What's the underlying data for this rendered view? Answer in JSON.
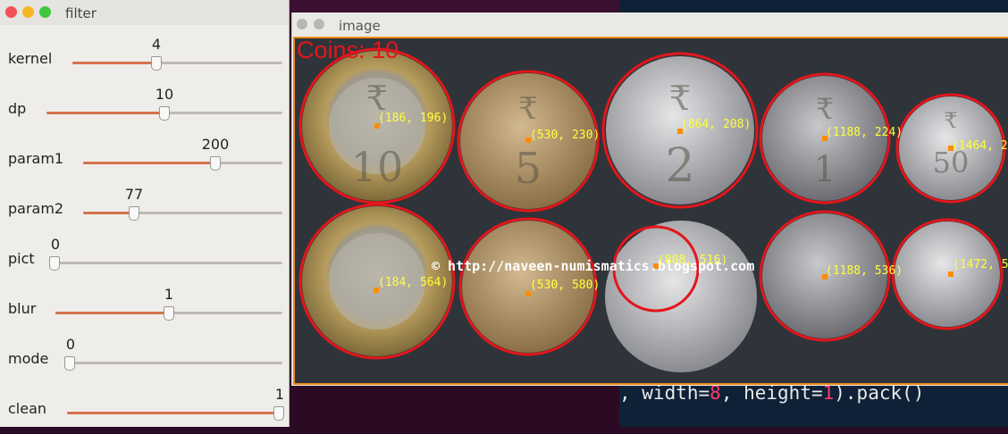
{
  "filter_window": {
    "title": "filter",
    "sliders": [
      {
        "label": "kernel",
        "value": "4",
        "fraction": 0.4
      },
      {
        "label": "dp",
        "value": "10",
        "fraction": 0.5
      },
      {
        "label": "param1",
        "value": "200",
        "fraction": 0.67
      },
      {
        "label": "param2",
        "value": "77",
        "fraction": 0.25
      },
      {
        "label": "pict",
        "value": "0",
        "fraction": 0.0
      },
      {
        "label": "blur",
        "value": "1",
        "fraction": 0.5
      },
      {
        "label": "mode",
        "value": "0",
        "fraction": 0.0
      },
      {
        "label": "clean",
        "value": "1",
        "fraction": 1.0
      }
    ]
  },
  "image_window": {
    "title": "image",
    "coins_text": "Coins: 10",
    "watermark": "© http://naveen-numismatics.blogspot.com",
    "coin_labels": [
      "(186, 196)",
      "(530, 230)",
      "(864, 208)",
      "(1188, 224)",
      "(1464, 2",
      "(184, 564)",
      "(530, 580)",
      "(808, 516)",
      "(1188, 536)",
      "(1472, 5"
    ]
  },
  "editor": {
    "line_parts": [
      ", width=",
      "8",
      ", height=",
      "1",
      ").pack()"
    ]
  },
  "colors": {
    "accent_orange": "#f08a1e",
    "slider_fill": "#d4724d",
    "circle_red": "#e3161b",
    "label_yellow": "#ffff3a"
  }
}
